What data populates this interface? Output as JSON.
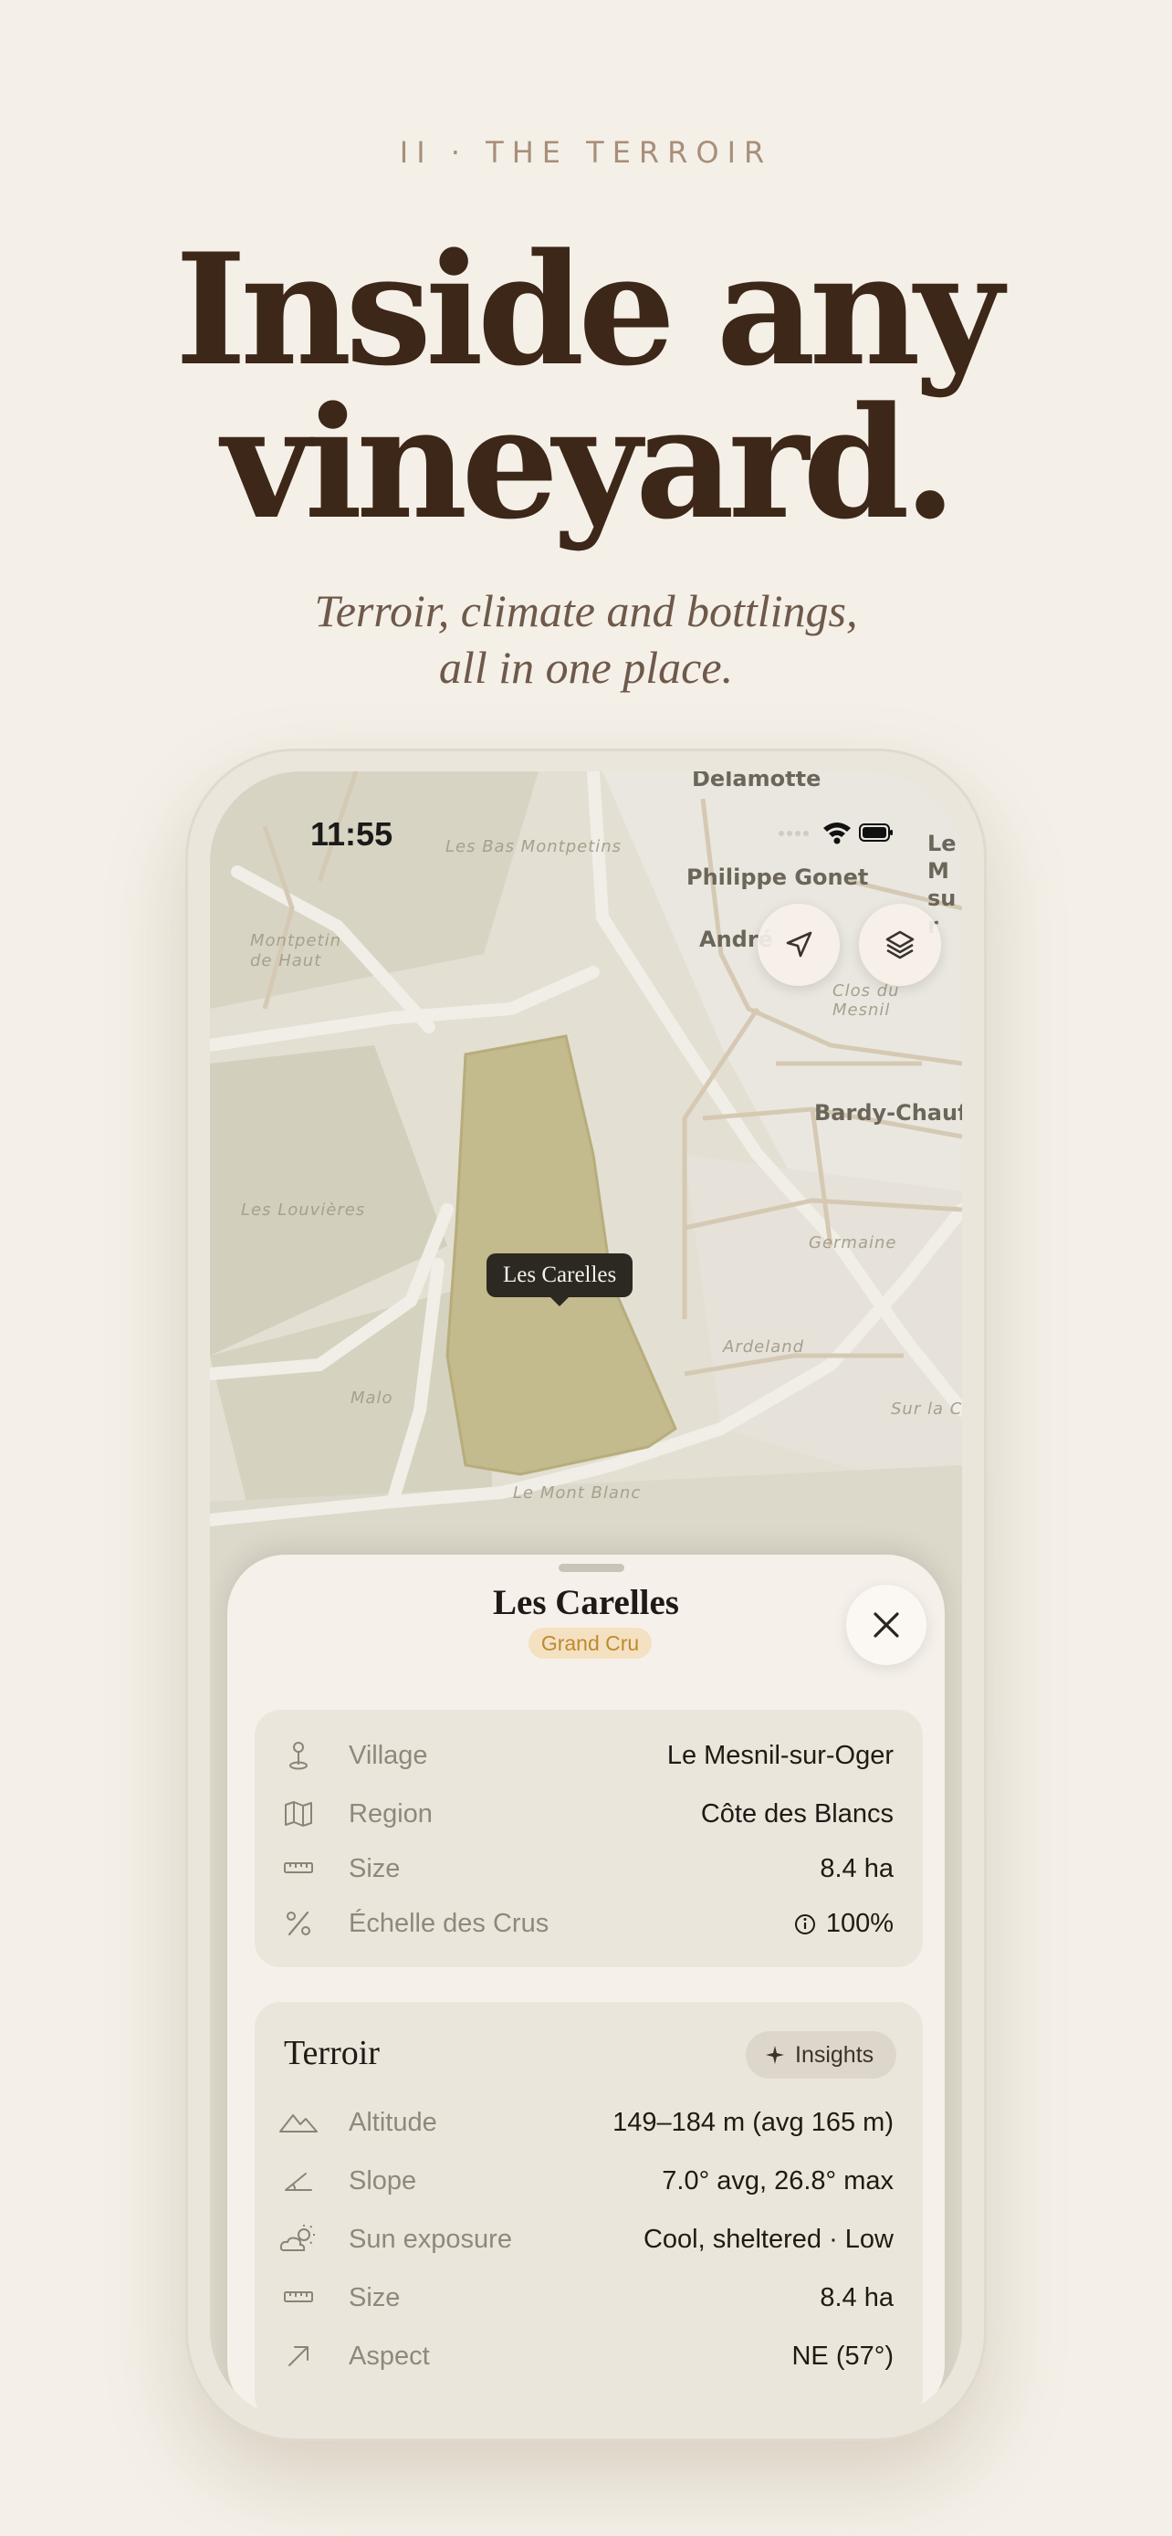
{
  "header": {
    "eyebrow": "II   ·   THE TERROIR",
    "headline_line1": "Inside any",
    "headline_line2": "vineyard.",
    "subtitle_line1": "Terroir, climate and bottlings,",
    "subtitle_line2": "all in one place."
  },
  "status_bar": {
    "time": "11:55"
  },
  "map": {
    "labels": {
      "delamotte": "Delamotte",
      "les_bas_montpetins": "Les Bas Montpetins",
      "montpetin_de_haut": "Montpetin de Haut",
      "philippe_gonet": "Philippe Gonet",
      "andre": "André",
      "clos_du_mesnil": "Clos du Mesnil",
      "bardy_chauffe": "Bardy-Chauffe",
      "le_mesnil_partial": "Le M sur",
      "les_louvieres": "Les Louvières",
      "germaine": "Germaine",
      "ardeland": "Ardeland",
      "sur_la_co": "Sur la Co",
      "malo": "Malo",
      "le_mont_blanc": "Le Mont Blanc"
    },
    "selected_parcel_tooltip": "Les Carelles",
    "buttons": {
      "locate_icon": "location-arrow-icon",
      "layers_icon": "layers-icon"
    }
  },
  "sheet": {
    "title": "Les Carelles",
    "badge": "Grand Cru",
    "info": [
      {
        "icon": "pin-icon",
        "label": "Village",
        "value": "Le Mesnil-sur-Oger"
      },
      {
        "icon": "map-icon",
        "label": "Region",
        "value": "Côte des Blancs"
      },
      {
        "icon": "ruler-icon",
        "label": "Size",
        "value": "8.4 ha"
      },
      {
        "icon": "percent-icon",
        "label": "Échelle des Crus",
        "value": "100%"
      }
    ],
    "terroir": {
      "title": "Terroir",
      "insights_label": "Insights",
      "rows": [
        {
          "icon": "mountains-icon",
          "label": "Altitude",
          "value": "149–184 m (avg 165 m)"
        },
        {
          "icon": "slope-icon",
          "label": "Slope",
          "value": "7.0° avg, 26.8° max"
        },
        {
          "icon": "sun-cloud-icon",
          "label": "Sun exposure",
          "value": "Cool, sheltered · Low"
        },
        {
          "icon": "ruler-icon",
          "label": "Size",
          "value": "8.4 ha"
        },
        {
          "icon": "arrow-up-right-icon",
          "label": "Aspect",
          "value": "NE (57°)"
        }
      ]
    }
  }
}
